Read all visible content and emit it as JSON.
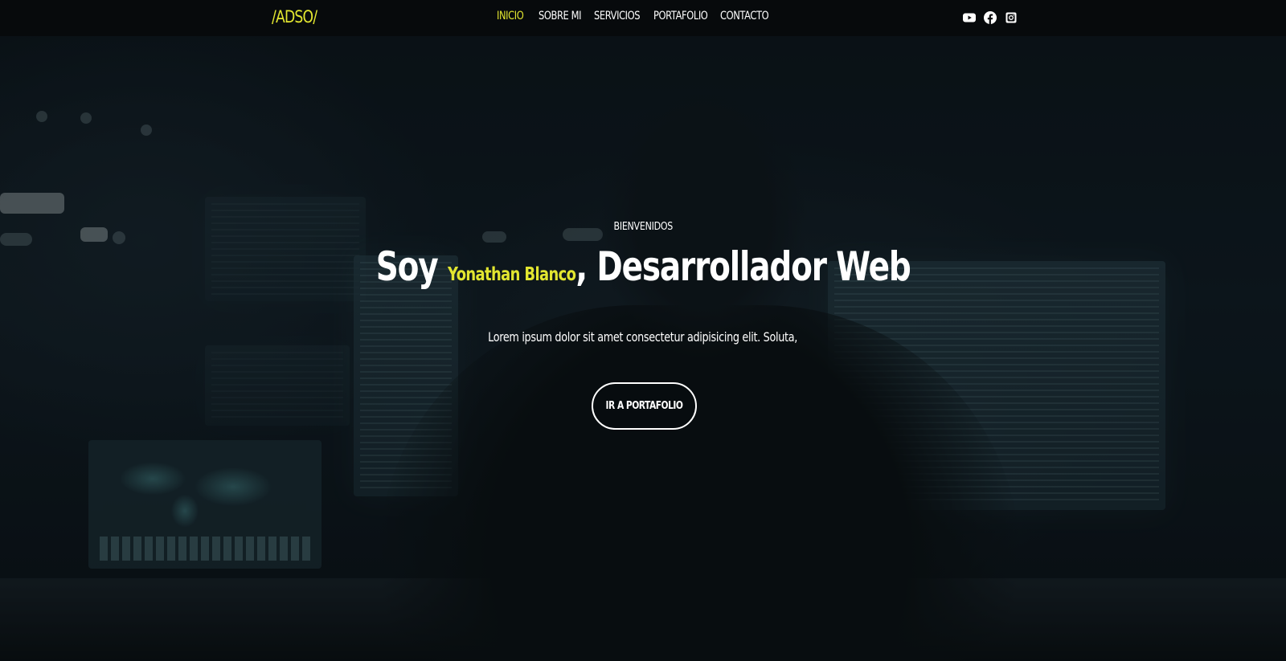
{
  "brand": {
    "logo": "/ADSO/"
  },
  "nav": {
    "items": [
      {
        "label": "INICIO",
        "active": true
      },
      {
        "label": "SOBRE MI"
      },
      {
        "label": "SERVICIOS"
      },
      {
        "label": "PORTAFOLIO"
      },
      {
        "label": "CONTACTO"
      }
    ]
  },
  "socials": [
    {
      "icon": "youtube-icon"
    },
    {
      "icon": "facebook-icon"
    },
    {
      "icon": "instagram-icon"
    }
  ],
  "hero": {
    "kicker": "BIENVENIDOS",
    "title_prefix": "Soy",
    "name": "Yonathan Blanco",
    "title_suffix": ", Desarrollador Web",
    "lead": "Lorem ipsum dolor sit amet consectetur adipisicing elit. Soluta,",
    "cta_label": "IR A PORTAFOLIO"
  },
  "colors": {
    "accent": "#e2e630",
    "navbar": "#080a0c",
    "text": "#ffffff"
  }
}
